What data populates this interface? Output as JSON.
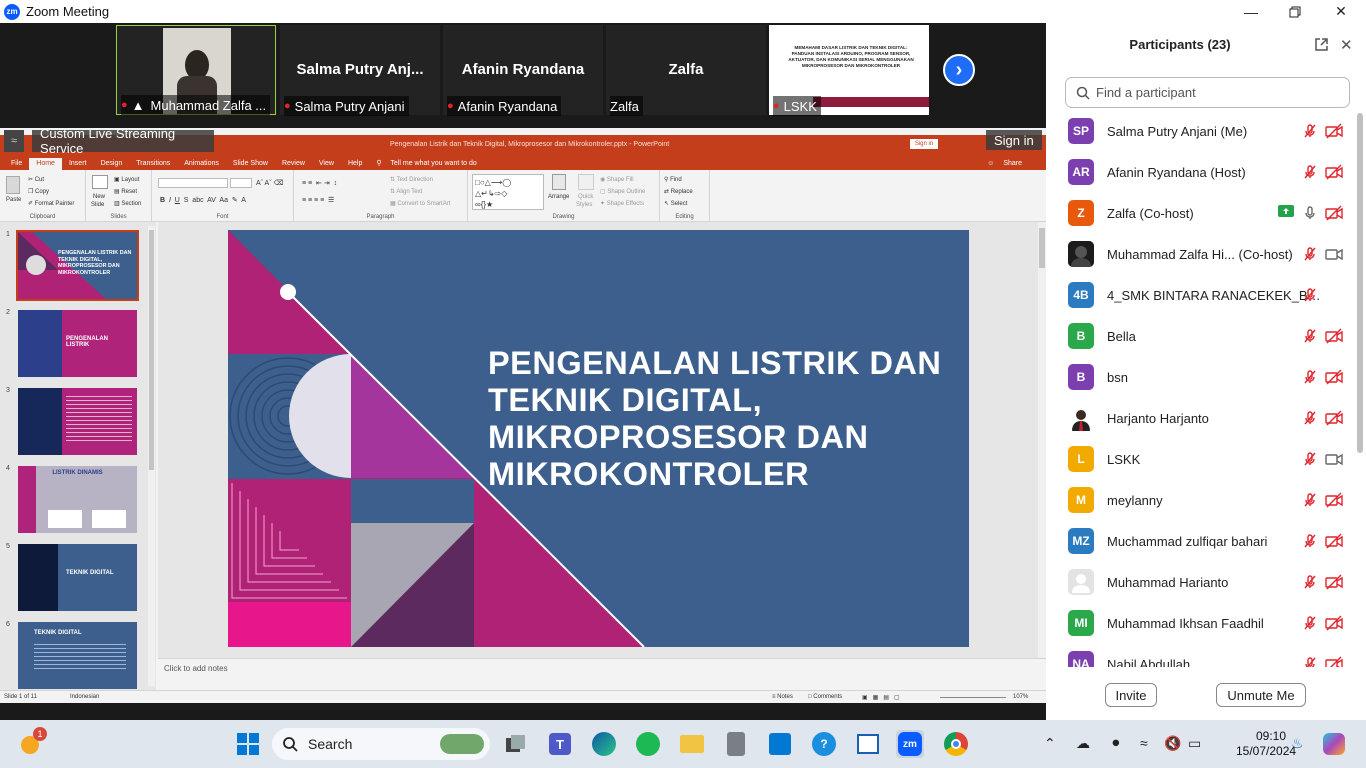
{
  "window": {
    "title": "Zoom Meeting",
    "logo": "zm"
  },
  "videos": [
    {
      "big": "",
      "name": "Muhammad Zalfa ..."
    },
    {
      "big": "Salma  Putry  Anj...",
      "name": "Salma Putry Anjani"
    },
    {
      "big": "Afanin Ryandana",
      "name": "Afanin Ryandana"
    },
    {
      "big": "Zalfa",
      "name": "Zalfa"
    },
    {
      "big": "",
      "name": "LSKK"
    }
  ],
  "lskk_preview": "MEMAHAMI DASAR LISTRIK DAN TEKNIK DIGITAL: PANDUAN INSTALASI ARDUINO, PROGRAM SENSOR, AKTUATOR, DAN KOMUNIKASI SERIAL MENGGUNAKAN MIKROPROSESOR DAN MIKROKONTROLER",
  "live": {
    "label": "Custom Live Streaming Service",
    "signin": "Sign in"
  },
  "ppt": {
    "title": "Pengenalan Listrik dan Teknik Digital, Mikroprosesor dan Mikrokontroler.pptx  -  PowerPoint",
    "signin": "Sign in",
    "tabs": [
      "File",
      "Home",
      "Insert",
      "Design",
      "Transitions",
      "Animations",
      "Slide Show",
      "Review",
      "View",
      "Help"
    ],
    "tellme": "Tell me what you want to do",
    "share": "Share",
    "groups": {
      "clipboard": "Clipboard",
      "slides": "Slides",
      "font": "Font",
      "paragraph": "Paragraph",
      "drawing": "Drawing",
      "editing": "Editing"
    },
    "clip": {
      "paste": "Paste",
      "cut": "Cut",
      "copy": "Copy",
      "format": "Format Painter"
    },
    "slides_btns": {
      "new": "New",
      "slide": "Slide",
      "layout": "Layout",
      "reset": "Reset",
      "section": "Section"
    },
    "para_btns": {
      "text_direction": "Text Direction",
      "align_text": "Align Text",
      "smartart": "Convert to SmartArt"
    },
    "draw_btns": {
      "arrange": "Arrange",
      "quick": "Quick",
      "styles": "Styles",
      "fill": "Shape Fill",
      "outline": "Shape Outline",
      "effects": "Shape Effects"
    },
    "edit_btns": {
      "find": "Find",
      "replace": "Replace",
      "select": "Select"
    },
    "thumbs": [
      {
        "n": "1",
        "text": "PENGENALAN LISTRIK DAN TEKNIK DIGITAL, MIKROPROSESOR DAN MIKROKONTROLER"
      },
      {
        "n": "2",
        "text": "PENGENALAN LISTRIK"
      },
      {
        "n": "3",
        "text": ""
      },
      {
        "n": "4",
        "text": "LISTRIK DINAMIS"
      },
      {
        "n": "5",
        "text": "TEKNIK DIGITAL"
      },
      {
        "n": "6",
        "text": "TEKNIK DIGITAL"
      }
    ],
    "slide_title": "PENGENALAN LISTRIK DAN TEKNIK DIGITAL, MIKROPROSESOR DAN MIKROKONTROLER",
    "notes_placeholder": "Click to add notes",
    "status": {
      "slide": "Slide 1 of 11",
      "lang": "Indonesian",
      "notes": "Notes",
      "comments": "Comments",
      "zoom": "107%"
    }
  },
  "participants": {
    "title": "Participants (23)",
    "search_placeholder": "Find a participant",
    "list": [
      {
        "initials": "SP",
        "name": "Salma Putry Anjani (Me)",
        "color": "#7b3fb0",
        "mic": "off",
        "video": "off"
      },
      {
        "initials": "AR",
        "name": "Afanin Ryandana (Host)",
        "color": "#7b3fb0",
        "mic": "off",
        "video": "off"
      },
      {
        "initials": "Z",
        "name": "Zalfa (Co-host)",
        "color": "#e8590c",
        "mic": "on",
        "video": "off",
        "sharing": true
      },
      {
        "initials": "",
        "name": "Muhammad Zalfa Hi...   (Co-host)",
        "color": "#333333",
        "mic": "off",
        "video": "on"
      },
      {
        "initials": "4B",
        "name": "4_SMK BINTARA RANACEKEK_BAN...",
        "color": "#2a7bbf",
        "mic": "off",
        "video": "none"
      },
      {
        "initials": "B",
        "name": "Bella",
        "color": "#2aa84a",
        "mic": "off",
        "video": "off"
      },
      {
        "initials": "B",
        "name": "bsn",
        "color": "#7b3fb0",
        "mic": "off",
        "video": "off"
      },
      {
        "initials": "",
        "name": "Harjanto Harjanto",
        "color": "#ffffff",
        "mic": "off",
        "video": "off"
      },
      {
        "initials": "L",
        "name": "LSKK",
        "color": "#f2a900",
        "mic": "off",
        "video": "on"
      },
      {
        "initials": "M",
        "name": "meylanny",
        "color": "#f2a900",
        "mic": "off",
        "video": "off"
      },
      {
        "initials": "MZ",
        "name": "Muchammad zulfiqar bahari",
        "color": "#2a7bbf",
        "mic": "off",
        "video": "off"
      },
      {
        "initials": "",
        "name": "Muhammad Harianto",
        "color": "#e3e3e3",
        "mic": "off",
        "video": "off"
      },
      {
        "initials": "MI",
        "name": "Muhammad Ikhsan Faadhil",
        "color": "#2aa84a",
        "mic": "off",
        "video": "off"
      },
      {
        "initials": "NA",
        "name": "Nabil Abdullah",
        "color": "#7b3fb0",
        "mic": "off",
        "video": "off"
      }
    ],
    "invite": "Invite",
    "unmute": "Unmute Me"
  },
  "taskbar": {
    "search": "Search",
    "time": "09:10",
    "date": "15/07/2024",
    "notif_badge": "1"
  }
}
